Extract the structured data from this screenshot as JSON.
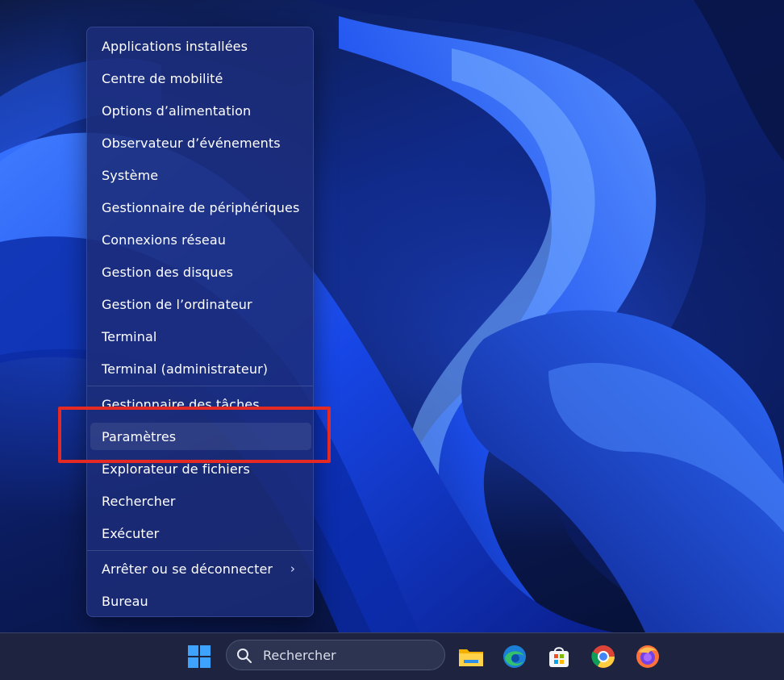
{
  "context_menu": {
    "items": [
      {
        "label": "Applications installées"
      },
      {
        "label": "Centre de mobilité"
      },
      {
        "label": "Options d’alimentation"
      },
      {
        "label": "Observateur d’événements"
      },
      {
        "label": "Système"
      },
      {
        "label": "Gestionnaire de périphériques"
      },
      {
        "label": "Connexions réseau"
      },
      {
        "label": "Gestion des disques"
      },
      {
        "label": "Gestion de l’ordinateur"
      },
      {
        "label": "Terminal"
      },
      {
        "label": "Terminal (administrateur)"
      },
      {
        "label": "Gestionnaire des tâches"
      },
      {
        "label": "Paramètres"
      },
      {
        "label": "Explorateur de fichiers"
      },
      {
        "label": "Rechercher"
      },
      {
        "label": "Exécuter"
      },
      {
        "label": "Arrêter ou se déconnecter",
        "submenu_icon": "chevron-right-icon",
        "submenu_glyph": "›"
      },
      {
        "label": "Bureau"
      }
    ],
    "hovered_item": "Paramètres",
    "highlight_color": "#e42a22"
  },
  "taskbar": {
    "search": {
      "placeholder": "Rechercher",
      "icon": "search-icon"
    },
    "pinned": [
      {
        "name": "start-icon"
      },
      {
        "name": "file-explorer-icon"
      },
      {
        "name": "edge-icon"
      },
      {
        "name": "microsoft-store-icon"
      },
      {
        "name": "chrome-icon"
      },
      {
        "name": "firefox-icon"
      }
    ]
  },
  "colors": {
    "accent": "#1f6fff",
    "menu_bg": "#1c2c78",
    "taskbar_bg": "#1e2440"
  }
}
